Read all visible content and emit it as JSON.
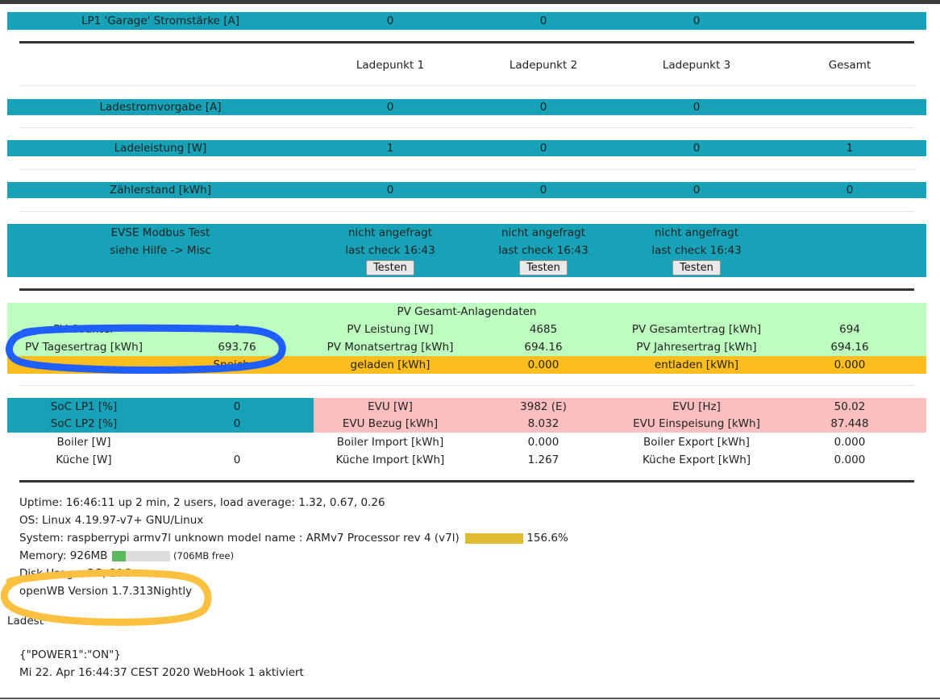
{
  "lp1_current": {
    "label": "LP1 'Garage' Stromstärke [A]",
    "v1": "0",
    "v2": "0",
    "v3": "0"
  },
  "header": {
    "c1": "Ladepunkt 1",
    "c2": "Ladepunkt 2",
    "c3": "Ladepunkt 3",
    "c4": "Gesamt"
  },
  "ladestrom": {
    "label": "Ladestromvorgabe [A]",
    "v1": "0",
    "v2": "0",
    "v3": "0"
  },
  "ladeleistung": {
    "label": "Ladeleistung [W]",
    "v1": "1",
    "v2": "0",
    "v3": "0",
    "total": "1"
  },
  "zaehler": {
    "label": "Zählerstand [kWh]",
    "v1": "0",
    "v2": "0",
    "v3": "0",
    "total": "0"
  },
  "evse": {
    "label1": "EVSE Modbus Test",
    "label2": "siehe Hilfe -> Misc",
    "status": "nicht angefragt",
    "last_check": "last check 16:43",
    "button": "Testen"
  },
  "pv": {
    "title": "PV Gesamt-Anlagendaten",
    "counter_label": "PV Counter",
    "counter_value": "0",
    "leistung_label": "PV Leistung [W]",
    "leistung_value": "4685",
    "gesamt_label": "PV Gesamtertrag [kWh]",
    "gesamt_value": "694",
    "tages_label": "PV Tagesertrag [kWh]",
    "tages_value": "693.76",
    "monat_label": "PV Monatsertrag [kWh]",
    "monat_value": "694.16",
    "jahres_label": "PV Jahresertrag [kWh]",
    "jahres_value": "694.16"
  },
  "speicher": {
    "label": "Speicher",
    "geladen_label": "geladen [kWh]",
    "geladen_value": "0.000",
    "entladen_label": "entladen [kWh]",
    "entladen_value": "0.000"
  },
  "soc": {
    "lp1_label": "SoC LP1 [%]",
    "lp1_value": "0",
    "lp2_label": "SoC LP2 [%]",
    "lp2_value": "0"
  },
  "evu": {
    "w_label": "EVU [W]",
    "w_value": "3982 (E)",
    "hz_label": "EVU [Hz]",
    "hz_value": "50.02",
    "bezug_label": "EVU Bezug [kWh]",
    "bezug_value": "8.032",
    "einsp_label": "EVU Einspeisung [kWh]",
    "einsp_value": "87.448"
  },
  "boiler": {
    "label": "Boiler [W]",
    "value": "",
    "import_label": "Boiler Import [kWh]",
    "import_value": "0.000",
    "export_label": "Boiler Export [kWh]",
    "export_value": "0.000"
  },
  "kueche": {
    "label": "Küche [W]",
    "value": "0",
    "import_label": "Küche Import [kWh]",
    "import_value": "1.267",
    "export_label": "Küche Export [kWh]",
    "export_value": "0.000"
  },
  "system": {
    "uptime": "Uptime: 16:46:11 up 2 min, 2 users, load average: 1.32, 0.67, 0.26",
    "os": "OS: Linux 4.19.97-v7+ GNU/Linux",
    "cpu": "System: raspberrypi armv7l unknown model name : ARMv7 Processor rev 4 (v7l)",
    "cpu_percent": "156.6%",
    "cpu_level": 1.0,
    "memory": "Memory: 926MB",
    "memory_free": "(706MB free)",
    "memory_level": 0.24,
    "disk": "Disk Usage: 3G, 29G a... ",
    "version": "openWB Version 1.7.313Nightly",
    "lades": "Ladest...",
    "power": "{\"POWER1\":\"ON\"}",
    "webhook": "Mi 22. Apr 16:44:37 CEST 2020 WebHook 1 aktiviert"
  },
  "colors": {
    "teal": "#17a2b8",
    "green": "#bdfdbf",
    "orange": "#fcbe1e",
    "pink": "#fcbfbf",
    "annotation_blue": "#1f5fff",
    "annotation_orange": "#fbc040"
  }
}
